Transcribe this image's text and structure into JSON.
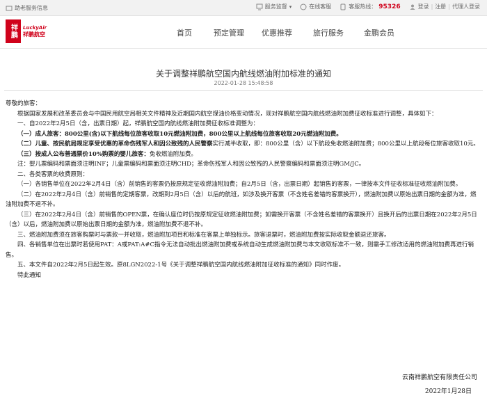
{
  "topbar": {
    "accessibility": "助老服务信息",
    "service_monitor": "服务监督",
    "online_service": "在线客服",
    "hotline_label": "客服热线：",
    "hotline_number": "95326",
    "login": "登录",
    "register": "注册",
    "agent_login": "代理人登录",
    "separator": "|"
  },
  "logo": {
    "mark": "祥鹏",
    "en": "LuckyAir",
    "cn": "祥鹏航空"
  },
  "nav": [
    "首页",
    "预定管理",
    "优惠推荐",
    "旅行服务",
    "金鹏会员"
  ],
  "article": {
    "title": "关于调整祥鹏航空国内航线燃油附加标准的通知",
    "date": "2022-01-28 15:48:58",
    "greeting": "尊敬的旅客：",
    "p1": "根据国家发展和改革委员会与中国民用航空局相关文件精神及近期国内航空煤油价格变动情况，现对祥鹏航空国内航线燃油附加费征收标准进行调整，具体如下：",
    "p2": "一、自2022年2月5日（含，出票日期）起，祥鹏航空国内航线燃油附加费征收标准调整为：",
    "p3": "（一）成人旅客：800公里(含)以下航线每位旅客收取10元燃油附加费，800公里以上航线每位旅客收取20元燃油附加费。",
    "p4_bold": "（二）儿童、按民航局规定享受优惠的革命伤残军人和因公致残的人民警察",
    "p4_rest": "实行减半收取，即：800公里（含）以下航段免收燃油附加费；800公里以上航段每位旅客收取10元。",
    "p5_bold": "（三）按成人公布普通票价10%购票的婴儿旅客：",
    "p5_rest": "免收燃油附加费。",
    "p6": "注：婴儿票编码和票面须注明INF；儿童票编码和票面须注明CHD；革命伤残军人和因公致残的人民警察编码和票面须注明GM/JC。",
    "p7": "二、各类客票的收费原则：",
    "p8": "（一）各销售单位在2022年2月4日（含）前销售的客票仍按原规定征收燃油附加费；自2月5日（含，出票日期）起销售的客票，一律按本文件征收标准征收燃油附加费。",
    "p9": "（二）在2022年2月4日（含）前销售的定期客票，改期到2月5日（含）以后的航班，如涉及换开客票（不含姓名差错的客票换开），燃油附加费以原始出票日期的金额为准，燃油附加费不退不补。",
    "p10": "（三）在2022年2月4日（含）前销售的OPEN票，在确认座位时仍按原规定征收燃油附加费；如需换开客票（不含姓名差错的客票换开）且换开后的出票日期在2022年2月5日（含）以后，燃油附加费以原始出票日期的金额为准，燃油附加费不退不补。",
    "p11": "三、燃油附加费须在旅客购票时与票款一并收取，燃油附加项目和标准在客票上单独标示。旅客退票时，燃油附加费按实际收取金额退还旅客。",
    "p12": "四、各销售单位在出票时若使用PAT：A或PAT:A#C指令无法自动批出燃油附加费或系统自动生成燃油附加费与本文收取标准不一致，则需手工修改适用的燃油附加费再进行销售。",
    "p13": "五、本文件自2022年2月5日起生效。原8LGN2022-1号《关于调整祥鹏航空国内航线燃油附加征收标准的通知》同时作废。",
    "p14": "特此通知",
    "signature": "云南祥鹏航空有限责任公司",
    "sign_date": "2022年1月28日"
  },
  "colors": {
    "brand_red": "#d0021b"
  }
}
